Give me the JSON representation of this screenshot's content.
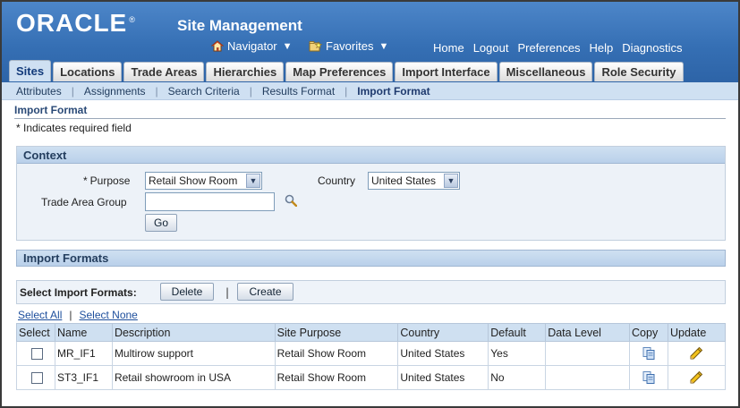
{
  "header": {
    "logo": "ORACLE",
    "logo_mark": "®",
    "app_title": "Site Management",
    "navigator": "Navigator",
    "favorites": "Favorites",
    "global_links": [
      "Home",
      "Logout",
      "Preferences",
      "Help",
      "Diagnostics"
    ]
  },
  "tabs": [
    {
      "label": "Sites",
      "active": true
    },
    {
      "label": "Locations"
    },
    {
      "label": "Trade Areas"
    },
    {
      "label": "Hierarchies"
    },
    {
      "label": "Map Preferences"
    },
    {
      "label": "Import Interface"
    },
    {
      "label": "Miscellaneous"
    },
    {
      "label": "Role Security"
    }
  ],
  "subtabs": [
    {
      "label": "Attributes"
    },
    {
      "label": "Assignments"
    },
    {
      "label": "Search Criteria"
    },
    {
      "label": "Results Format"
    },
    {
      "label": "Import Format",
      "active": true
    }
  ],
  "page": {
    "title": "Import Format",
    "required_note": "* Indicates required field"
  },
  "context": {
    "heading": "Context",
    "purpose_label": "Purpose",
    "purpose_star": "*",
    "purpose_value": "Retail Show Room",
    "country_label": "Country",
    "country_value": "United States",
    "trade_area_group_label": "Trade Area Group",
    "trade_area_group_value": "",
    "go_label": "Go"
  },
  "imports": {
    "heading": "Import Formats",
    "select_label": "Select Import Formats:",
    "delete_label": "Delete",
    "separator": "|",
    "create_label": "Create",
    "select_all": "Select All",
    "select_none": "Select None",
    "columns": [
      "Select",
      "Name",
      "Description",
      "Site Purpose",
      "Country",
      "Default",
      "Data Level",
      "Copy",
      "Update"
    ],
    "rows": [
      {
        "name": "MR_IF1",
        "description": "Multirow support",
        "site_purpose": "Retail Show Room",
        "country": "United States",
        "default": "Yes",
        "data_level": ""
      },
      {
        "name": "ST3_IF1",
        "description": "Retail showroom in USA",
        "site_purpose": "Retail Show Room",
        "country": "United States",
        "default": "No",
        "data_level": ""
      }
    ]
  },
  "colors": {
    "header_blue": "#356fb4",
    "tab_active": "#cfe0f2",
    "section_head": "#b9d0ea",
    "link": "#1d4e9c"
  },
  "icons": {
    "navigator": "home-icon",
    "favorites": "favorites-icon",
    "search": "search-icon",
    "copy": "copy-icon",
    "update": "pencil-icon"
  }
}
